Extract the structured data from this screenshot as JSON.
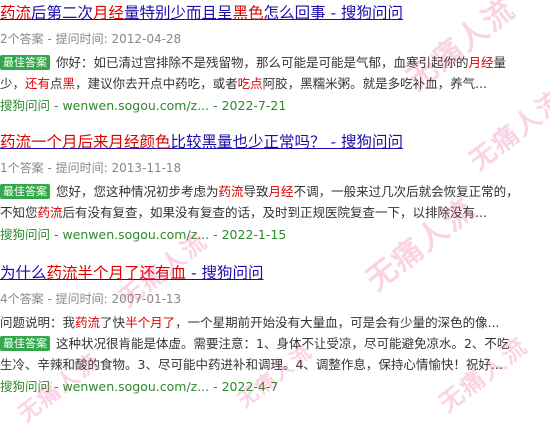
{
  "results": [
    {
      "title_parts": [
        {
          "text": "药流",
          "hl": true
        },
        {
          "text": "后第二次",
          "hl": false
        },
        {
          "text": "月经",
          "hl": true
        },
        {
          "text": "量特别少而且呈",
          "hl": false
        },
        {
          "text": "黑色",
          "hl": true
        },
        {
          "text": "怎么回事 - 搜狗问问",
          "hl": false
        }
      ],
      "meta": "2个答案 - 提问时间: 2012-04-28",
      "body_lines": [
        [
          {
            "badge": "最佳答案"
          },
          {
            "text": "你好：如已清过宫排除不是残留物，那么可能是可能是气郁，血寒引起你的",
            "hl": false
          },
          {
            "text": "月经",
            "hl": true
          },
          {
            "text": "量",
            "hl": false
          }
        ],
        [
          {
            "text": "少，",
            "hl": false
          },
          {
            "text": "还有",
            "hl": true
          },
          {
            "text": "点",
            "hl": false
          },
          {
            "text": "黑",
            "hl": true
          },
          {
            "text": "，建议你去开点中药吃，或者",
            "hl": false
          },
          {
            "text": "吃点",
            "hl": true
          },
          {
            "text": "阿胶，黑糯米粥。就是多吃补血，养气...",
            "hl": false
          }
        ]
      ],
      "url": "搜狗问问 - wenwen.sogou.com/z... - 2022-7-21"
    },
    {
      "title_parts": [
        {
          "text": "药流一个月后来月经颜色",
          "hl": true
        },
        {
          "text": "比较黑量也少正常吗？ - 搜狗问问",
          "hl": false
        }
      ],
      "meta": "1个答案 - 提问时间: 2013-11-18",
      "body_lines": [
        [
          {
            "badge": "最佳答案"
          },
          {
            "text": "您好，您这种情况初步考虑为",
            "hl": false
          },
          {
            "text": "药流",
            "hl": true
          },
          {
            "text": "导致",
            "hl": false
          },
          {
            "text": "月经",
            "hl": true
          },
          {
            "text": "不调，一般来过几次后就会恢复正常的，",
            "hl": false
          }
        ],
        [
          {
            "text": "不知您",
            "hl": false
          },
          {
            "text": "药流",
            "hl": true
          },
          {
            "text": "后有没有复查，如果没有复查的话，及时到正规医院复查一下，以排除没有...",
            "hl": false
          }
        ]
      ],
      "url": "搜狗问问 - wenwen.sogou.com/z... - 2022-1-15"
    },
    {
      "title_parts": [
        {
          "text": "为什么",
          "hl": false
        },
        {
          "text": "药流半个月了还有血",
          "hl": true
        },
        {
          "text": " - 搜狗问问",
          "hl": false
        }
      ],
      "meta": "4个答案 - 提问时间: 2007-01-13",
      "body_lines": [
        [
          {
            "text": "问题说明：",
            "hl": false,
            "label": true
          },
          {
            "text": "我",
            "hl": false
          },
          {
            "text": "药流",
            "hl": true
          },
          {
            "text": "了快",
            "hl": false
          },
          {
            "text": "半个月了",
            "hl": true
          },
          {
            "text": "，一个星期前开始没有大量血，可是会有少量的深色的像...",
            "hl": false
          }
        ],
        [
          {
            "badge": "最佳答案"
          },
          {
            "text": "这种状况很肯能是体虚。需要注意：1、身体不让受凉，尽可能避免凉水。2、不吃",
            "hl": false
          }
        ],
        [
          {
            "text": "生冷、辛辣和酸的食物。3、尽可能中药进补和调理。4、调整作息，保持心情愉快！祝好...",
            "hl": false
          }
        ]
      ],
      "url": "搜狗问问 - wenwen.sogou.com/z... - 2022-4-7"
    }
  ],
  "watermark_text": "无痛人流",
  "colors": {
    "title": "#1a0dab",
    "highlight": "#dd0000",
    "badge": "#32a84a",
    "url": "#2d8a2d",
    "meta": "#888888"
  }
}
